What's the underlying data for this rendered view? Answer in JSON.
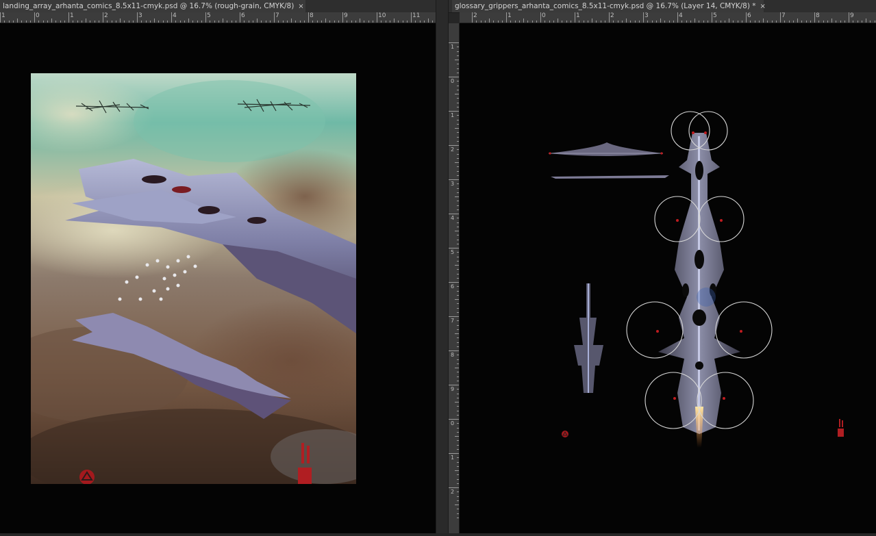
{
  "tabs": [
    {
      "title": "landing_array_arhanta_comics_8.5x11-cmyk.psd @ 16.7% (rough-grain, CMYK/8)",
      "close": "×"
    },
    {
      "title": "glossary_grippers_arhanta_comics_8.5x11-cmyk.psd @ 16.7% (Layer 14, CMYK/8) *",
      "close": "×"
    }
  ],
  "ruler_left": [
    "1",
    "0",
    "1",
    "2",
    "3",
    "4",
    "5",
    "6",
    "7",
    "8",
    "9",
    "10",
    "11"
  ],
  "ruler_right": [
    "2",
    "1",
    "0",
    "1",
    "2",
    "3",
    "4",
    "5",
    "6",
    "7",
    "8",
    "9"
  ],
  "ruler_right_v": [
    "1",
    "0",
    "1",
    "2",
    "3",
    "4",
    "5",
    "6",
    "7",
    "8",
    "9",
    "0",
    "1",
    "2"
  ],
  "colors": {
    "canvas": "#040404",
    "ui_bg": "#262626",
    "ring": "#d8d8d8",
    "accent_red": "#b01e22"
  }
}
